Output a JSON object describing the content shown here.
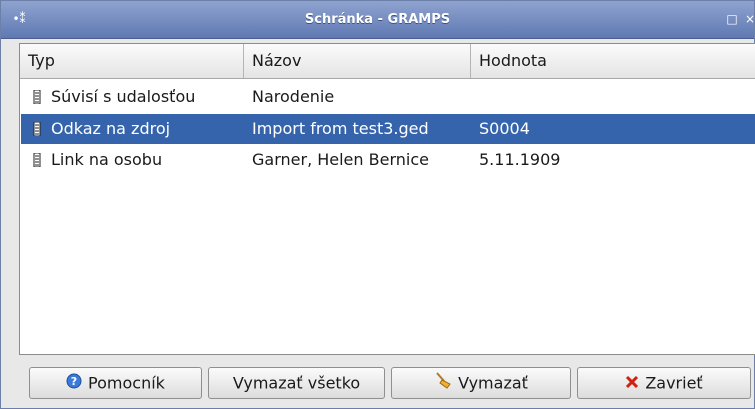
{
  "window": {
    "title": "Schránka - GRAMPS"
  },
  "columns": {
    "typ": "Typ",
    "nazov": "Názov",
    "hodnota": "Hodnota"
  },
  "rows": [
    {
      "typ": "Súvisí s udalosťou",
      "nazov": "Narodenie",
      "hodnota": "",
      "selected": false
    },
    {
      "typ": "Odkaz na zdroj",
      "nazov": "Import from test3.ged",
      "hodnota": "S0004",
      "selected": true
    },
    {
      "typ": "Link na osobu",
      "nazov": "Garner, Helen Bernice",
      "hodnota": "5.11.1909",
      "selected": false
    }
  ],
  "buttons": {
    "help_label": "Pomocník",
    "clear_all_label": "Vymazať všetko",
    "clear_label": "Vymazať",
    "close_label": "Zavrieť"
  },
  "icons": {
    "app": "app-menu-icon",
    "maximize": "maximize-icon",
    "close": "close-window-icon",
    "row_drag": "drag-handle-icon",
    "help": "help-icon",
    "clear": "broom-icon",
    "close_btn": "close-x-icon"
  },
  "colors": {
    "selection": "#3564ad",
    "titlebar": "#6f87bf",
    "close_x": "#d02010",
    "help_blue": "#3a7ad8"
  }
}
